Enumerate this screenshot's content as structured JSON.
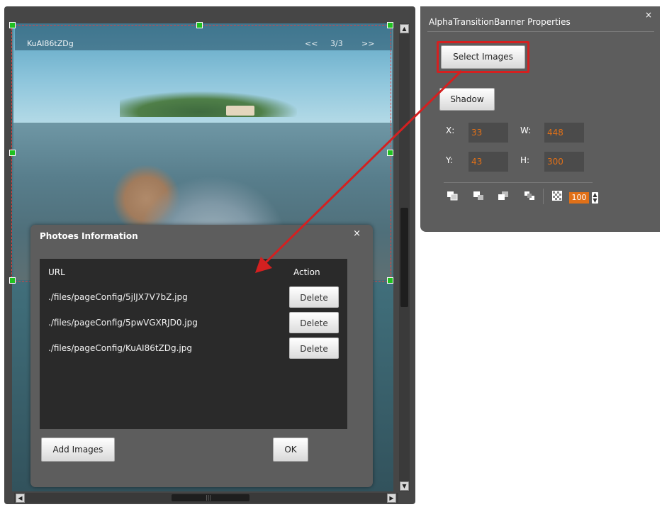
{
  "banner": {
    "title": "KuAI86tZDg",
    "prev": "<<",
    "counter": "3/3",
    "next": ">>"
  },
  "dialog": {
    "title": "Photoes Information",
    "close": "×",
    "col_url": "URL",
    "col_action": "Action",
    "rows": [
      {
        "url": "./files/pageConfig/5jlJX7V7bZ.jpg",
        "action": "Delete"
      },
      {
        "url": "./files/pageConfig/5pwVGXRJD0.jpg",
        "action": "Delete"
      },
      {
        "url": "./files/pageConfig/KuAI86tZDg.jpg",
        "action": "Delete"
      }
    ],
    "add_images": "Add Images",
    "ok": "OK"
  },
  "props": {
    "title": "AlphaTransitionBanner Properties",
    "close": "×",
    "select_images": "Select Images",
    "shadow": "Shadow",
    "x_label": "X:",
    "x_value": "33",
    "w_label": "W:",
    "w_value": "448",
    "y_label": "Y:",
    "y_value": "43",
    "h_label": "H:",
    "h_value": "300",
    "opacity": "100"
  },
  "icons": [
    "bring-to-front-icon",
    "bring-forward-icon",
    "send-backward-icon",
    "send-to-back-icon",
    "opacity-icon"
  ],
  "colors": {
    "panel": "#5d5d5d",
    "value_orange": "#e07018",
    "highlight_red": "#d42020",
    "handle_green": "#20c020"
  }
}
